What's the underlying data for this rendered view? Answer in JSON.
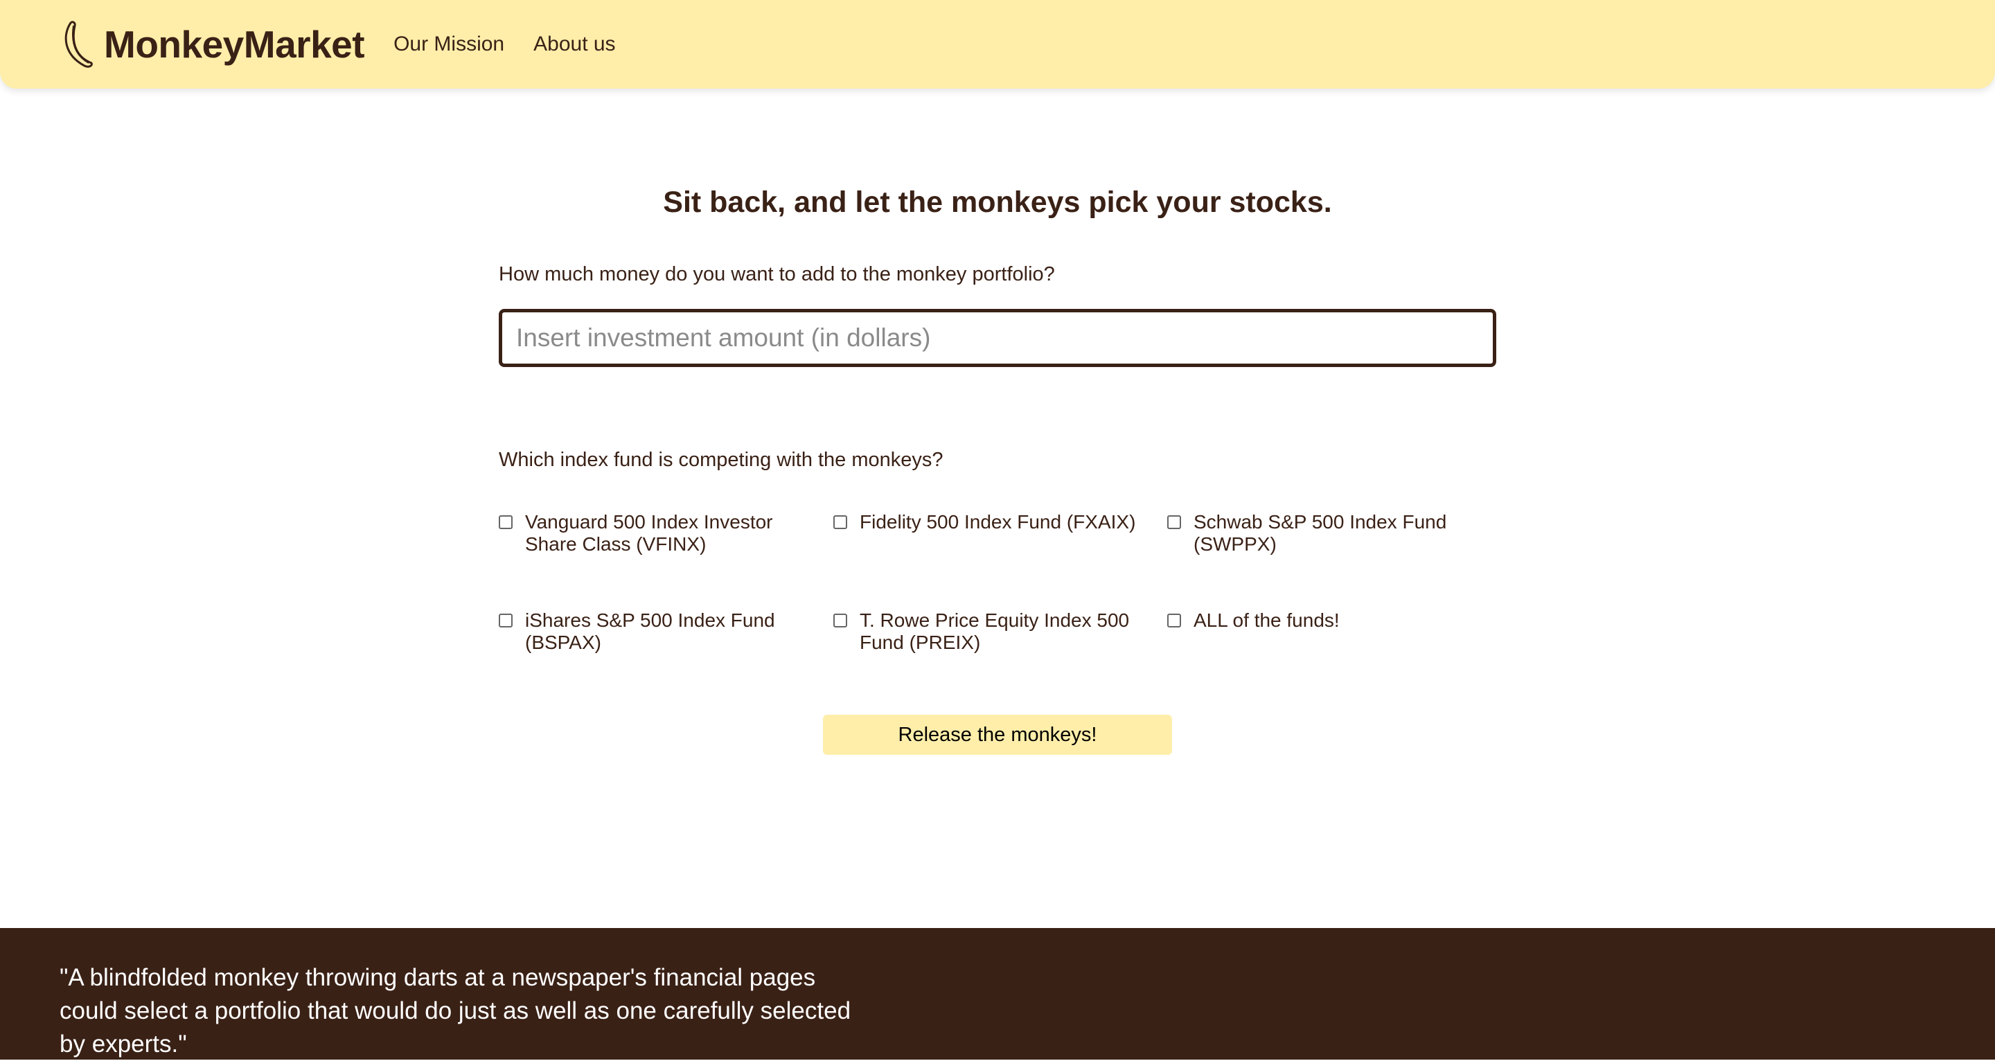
{
  "nav": {
    "brand": "MonkeyMarket",
    "links": [
      "Our Mission",
      "About us"
    ]
  },
  "main": {
    "headline": "Sit back, and let the monkeys pick your stocks.",
    "investment_question": "How much money do you want to add to the monkey portfolio?",
    "investment_placeholder": "Insert investment amount (in dollars)",
    "investment_value": "",
    "fund_question": "Which index fund is competing with the monkeys?",
    "funds": [
      {
        "label": "Vanguard 500 Index Investor Share Class (VFINX)",
        "checked": false
      },
      {
        "label": "Fidelity 500 Index Fund (FXAIX)",
        "checked": false
      },
      {
        "label": "Schwab S&P 500 Index Fund (SWPPX)",
        "checked": false
      },
      {
        "label": "iShares S&P 500 Index Fund (BSPAX)",
        "checked": false
      },
      {
        "label": "T. Rowe Price Equity Index 500 Fund (PREIX)",
        "checked": false
      },
      {
        "label": "ALL of the funds!",
        "checked": false
      }
    ],
    "submit_label": "Release the monkeys!"
  },
  "footer": {
    "quote": "\"A blindfolded monkey throwing darts at a newspaper's financial pages could select a portfolio that would do just as well as one carefully selected by experts.\""
  },
  "colors": {
    "accent": "#ffeeaa",
    "text": "#3a2116",
    "footer_bg": "#3a2116"
  },
  "icons": {
    "logo": "banana-icon"
  }
}
